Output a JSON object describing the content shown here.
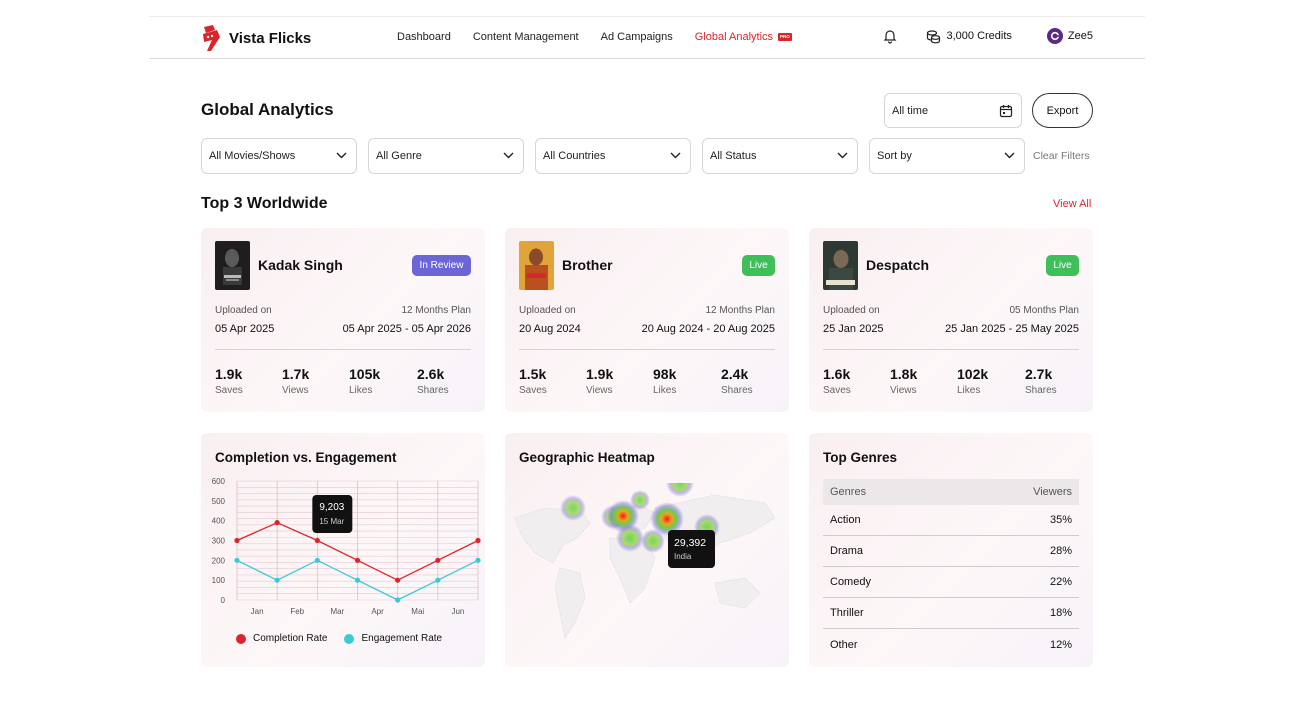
{
  "app": {
    "name": "Vista Flicks"
  },
  "nav": {
    "links": [
      "Dashboard",
      "Content Management",
      "Ad Campaigns"
    ],
    "active": "Global Analytics",
    "active_badge": "PRO",
    "credits": "3,000 Credits",
    "user": "Zee5"
  },
  "colors": {
    "accent": "#d8262c",
    "review": "#6b65d6",
    "live": "#3fbf5a",
    "completion": "#d8262c",
    "engagement": "#3ec8d6"
  },
  "header": {
    "title": "Global Analytics",
    "date_range": "All time",
    "export": "Export"
  },
  "filters": {
    "items": [
      "All Movies/Shows",
      "All Genre",
      "All Countries",
      "All Status",
      "Sort by"
    ],
    "clear": "Clear Filters"
  },
  "top": {
    "title": "Top 3 Worldwide",
    "view_all": "View All",
    "cards": [
      {
        "title": "Kadak Singh",
        "status": "In Review",
        "uploaded_label": "Uploaded on",
        "uploaded": "05 Apr 2025",
        "plan": "12 Months Plan",
        "range": "05 Apr 2025 - 05 Apr 2026",
        "stats": [
          {
            "v": "1.9k",
            "l": "Saves"
          },
          {
            "v": "1.7k",
            "l": "Views"
          },
          {
            "v": "105k",
            "l": "Likes"
          },
          {
            "v": "2.6k",
            "l": "Shares"
          }
        ]
      },
      {
        "title": "Brother",
        "status": "Live",
        "uploaded_label": "Uploaded on",
        "uploaded": "20 Aug 2024",
        "plan": "12 Months Plan",
        "range": "20 Aug 2024 - 20 Aug 2025",
        "stats": [
          {
            "v": "1.5k",
            "l": "Saves"
          },
          {
            "v": "1.9k",
            "l": "Views"
          },
          {
            "v": "98k",
            "l": "Likes"
          },
          {
            "v": "2.4k",
            "l": "Shares"
          }
        ]
      },
      {
        "title": "Despatch",
        "status": "Live",
        "uploaded_label": "Uploaded on",
        "uploaded": "25 Jan 2025",
        "plan": "05 Months Plan",
        "range": "25 Jan 2025 - 25 May 2025",
        "stats": [
          {
            "v": "1.6k",
            "l": "Saves"
          },
          {
            "v": "1.8k",
            "l": "Views"
          },
          {
            "v": "102k",
            "l": "Likes"
          },
          {
            "v": "2.7k",
            "l": "Shares"
          }
        ]
      }
    ]
  },
  "chart_panel": {
    "title": "Completion vs. Engagement",
    "tooltip_value": "9,203",
    "tooltip_date": "15 Mar"
  },
  "chart_data": {
    "type": "line",
    "title": "Completion vs. Engagement",
    "categories": [
      "Jan",
      "Feb",
      "Mar",
      "Apr",
      "Mai",
      "Jun"
    ],
    "x_positions": [
      0,
      1,
      2,
      3,
      4,
      5,
      6
    ],
    "yticks": [
      0,
      100,
      200,
      300,
      400,
      500,
      600
    ],
    "ylim": [
      0,
      600
    ],
    "grid": true,
    "legend": "bottom",
    "series": [
      {
        "name": "Completion Rate",
        "values": [
          300,
          390,
          300,
          200,
          100,
          200,
          300
        ]
      },
      {
        "name": "Engagement Rate",
        "values": [
          200,
          100,
          200,
          100,
          0,
          100,
          200
        ]
      }
    ]
  },
  "heatmap": {
    "title": "Geographic Heatmap",
    "tooltip_value": "29,392",
    "tooltip_label": "India"
  },
  "genres": {
    "title": "Top Genres",
    "headers": [
      "Genres",
      "Viewers"
    ],
    "rows": [
      {
        "name": "Action",
        "value": "35%"
      },
      {
        "name": "Drama",
        "value": "28%"
      },
      {
        "name": "Comedy",
        "value": "22%"
      },
      {
        "name": "Thriller",
        "value": "18%"
      },
      {
        "name": "Other",
        "value": "12%"
      }
    ]
  }
}
